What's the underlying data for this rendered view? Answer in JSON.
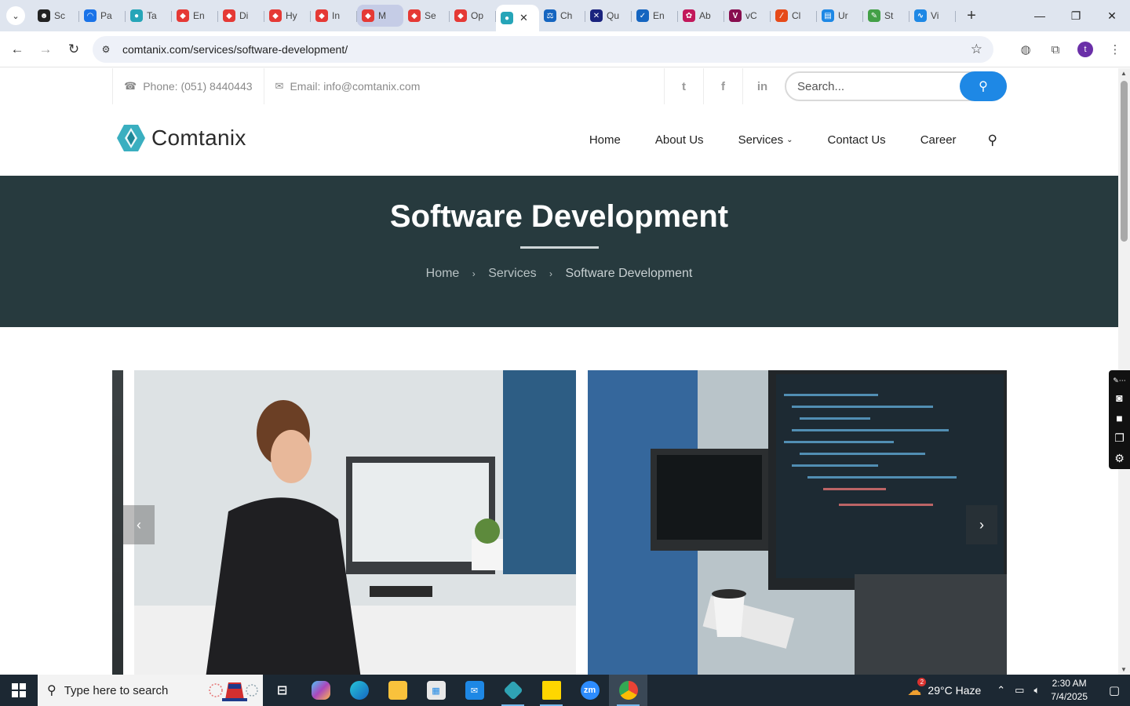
{
  "browser": {
    "tabs": [
      {
        "label": "Sc",
        "color": "#222222",
        "glyph": "☻"
      },
      {
        "label": "Pa",
        "color": "#1a73e8",
        "glyph": "◠"
      },
      {
        "label": "Ta",
        "color": "#26a5b8",
        "glyph": "●"
      },
      {
        "label": "En",
        "color": "#e53935",
        "glyph": "◆"
      },
      {
        "label": "Di",
        "color": "#e53935",
        "glyph": "◆"
      },
      {
        "label": "Hy",
        "color": "#e53935",
        "glyph": "◆"
      },
      {
        "label": "In",
        "color": "#e53935",
        "glyph": "◆"
      },
      {
        "label": "M",
        "color": "#e53935",
        "glyph": "◆"
      },
      {
        "label": "Se",
        "color": "#e53935",
        "glyph": "◆"
      },
      {
        "label": "Op",
        "color": "#e53935",
        "glyph": "◆"
      },
      {
        "label": "",
        "color": "#26a5b8",
        "glyph": "●"
      },
      {
        "label": "Ch",
        "color": "#1565c0",
        "glyph": "⚖"
      },
      {
        "label": "Qu",
        "color": "#1a237e",
        "glyph": "✕"
      },
      {
        "label": "En",
        "color": "#1565c0",
        "glyph": "✓"
      },
      {
        "label": "Ab",
        "color": "#c2185b",
        "glyph": "✿"
      },
      {
        "label": "vC",
        "color": "#880e4f",
        "glyph": "V"
      },
      {
        "label": "Cl",
        "color": "#e64a19",
        "glyph": "⁄"
      },
      {
        "label": "Ur",
        "color": "#1e88e5",
        "glyph": "▤"
      },
      {
        "label": "St",
        "color": "#43a047",
        "glyph": "✎"
      },
      {
        "label": "Vi",
        "color": "#1e88e5",
        "glyph": "∿"
      }
    ],
    "url": "comtanix.com/services/software-development/",
    "profile_initial": "t"
  },
  "site": {
    "phone": "Phone: (051) 8440443",
    "email": "Email: info@comtanix.com",
    "search_placeholder": "Search...",
    "brand": "Comtanix",
    "brand_color": "#2fa3b4",
    "nav": {
      "home": "Home",
      "about": "About Us",
      "services": "Services",
      "contact": "Contact Us",
      "career": "Career"
    },
    "hero": {
      "title": "Software Development",
      "crumb_home": "Home",
      "crumb_services": "Services",
      "crumb_current": "Software Development"
    }
  },
  "taskbar": {
    "search_placeholder": "Type here to search",
    "weather": "29°C  Haze",
    "weather_badge": "2",
    "time": "2:30 AM",
    "date": "7/4/2025"
  }
}
